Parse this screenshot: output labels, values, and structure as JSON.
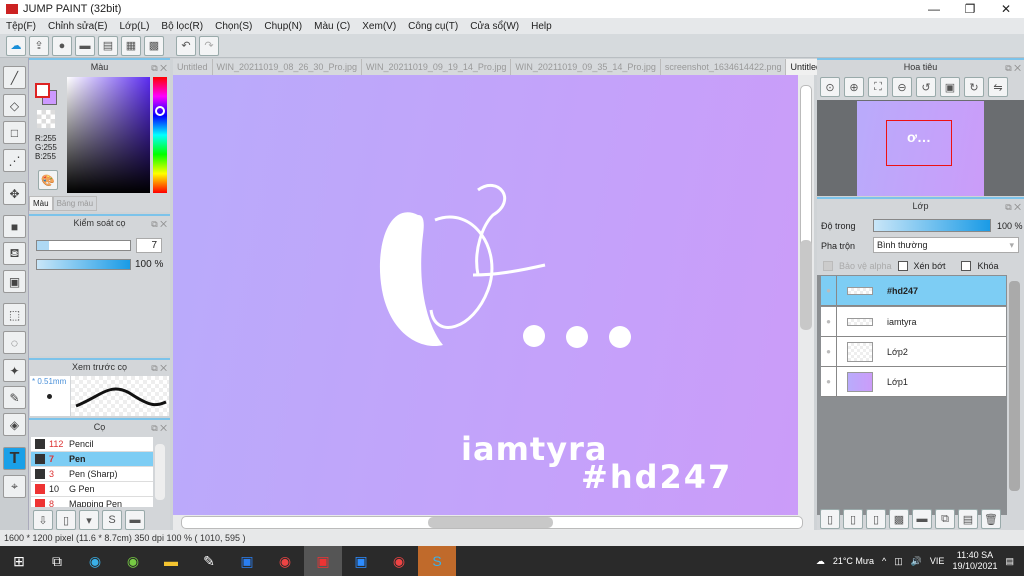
{
  "window": {
    "title": "JUMP PAINT (32bit)",
    "min": "—",
    "max": "❐",
    "close": "✕"
  },
  "menu": [
    "Tệp(F)",
    "Chỉnh sửa(E)",
    "Lớp(L)",
    "Bộ lọc(R)",
    "Chọn(S)",
    "Chụp(N)",
    "Màu (C)",
    "Xem(V)",
    "Công cụ(T)",
    "Cửa sổ(W)",
    "Help"
  ],
  "color_panel": {
    "title": "Màu",
    "r": "R:255",
    "g": "G:255",
    "b": "B:255",
    "tabs": [
      "Màu",
      "Bảng màu"
    ],
    "foreground": "#ffffff",
    "background": "#cc99ff"
  },
  "brush_control": {
    "title": "Kiểm soát cọ",
    "size": "7",
    "opacity": "100 %",
    "opacity_value": 100
  },
  "brush_preview": {
    "title": "Xem trước cọ",
    "size": "* 0.51mm"
  },
  "brushes": {
    "title": "Cọ",
    "items": [
      {
        "num": "112",
        "name": "Pencil",
        "color": "#333333"
      },
      {
        "num": "7",
        "name": "Pen",
        "color": "#333333",
        "selected": true
      },
      {
        "num": "3",
        "name": "Pen (Sharp)",
        "color": "#333333"
      },
      {
        "num": "10",
        "name": "G Pen",
        "color": "#ee3333"
      },
      {
        "num": "8",
        "name": "Mapping Pen",
        "color": "#ee3333"
      }
    ]
  },
  "tabs": [
    "Untitled",
    "WIN_20211019_08_26_30_Pro.jpg",
    "WIN_20211019_09_19_14_Pro.jpg",
    "WIN_20211019_09_35_14_Pro.jpg",
    "screenshot_1634614422.png",
    "Untitled"
  ],
  "artwork": {
    "text1": "iamtyra",
    "text2": "#hd247",
    "dots": "..."
  },
  "navigator": {
    "title": "Hoa tiêu"
  },
  "layers": {
    "title": "Lớp",
    "opacity_label": "Độ trong",
    "opacity": "100 %",
    "opacity_value": 100,
    "blend_label": "Pha trộn",
    "blend": "Bình thường",
    "protect_alpha": "Bảo vệ alpha",
    "clip": "Xén bớt",
    "lock": "Khóa",
    "items": [
      {
        "name": "#hd247",
        "selected": true
      },
      {
        "name": "iamtyra"
      },
      {
        "name": "Lớp2"
      },
      {
        "name": "Lớp1"
      }
    ]
  },
  "status": "1600 * 1200 pixel  (11.6 * 8.7cm)  350 dpi  100 %  ( 1010, 595 )",
  "taskbar": {
    "weather": "21°C  Mưa",
    "lang": "VIE",
    "time": "11:40 SA",
    "date": "19/10/2021"
  }
}
